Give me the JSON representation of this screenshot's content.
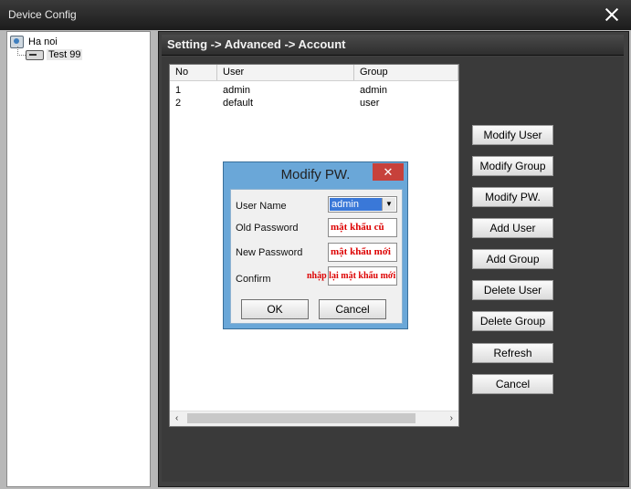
{
  "window": {
    "title": "Device Config"
  },
  "tree": {
    "root": "Ha noi",
    "child": "Test 99"
  },
  "breadcrumb": "Setting -> Advanced -> Account",
  "table": {
    "headers": {
      "no": "No",
      "user": "User",
      "group": "Group"
    },
    "rows": [
      {
        "no": "1",
        "user": "admin",
        "group": "admin"
      },
      {
        "no": "2",
        "user": "default",
        "group": "user"
      }
    ]
  },
  "buttons": {
    "modify_user": "Modify User",
    "modify_group": "Modify Group",
    "modify_pw": "Modify PW.",
    "add_user": "Add User",
    "add_group": "Add Group",
    "delete_user": "Delete User",
    "delete_group": "Delete Group",
    "refresh": "Refresh",
    "cancel": "Cancel"
  },
  "dialog": {
    "title": "Modify PW.",
    "close_glyph": "✕",
    "user_name_label": "User Name",
    "user_name_value": "admin",
    "old_password_label": "Old Password",
    "old_password_value": "mật khẩu cũ",
    "new_password_label": "New Password",
    "new_password_value": "mật khẩu mới",
    "confirm_label": "Confirm",
    "confirm_value": "nhập lại mật khẩu mới",
    "ok": "OK",
    "cancel": "Cancel"
  },
  "icons": {
    "close": "close-icon",
    "tree_root": "globe-icon",
    "tree_child": "device-icon",
    "dropdown": "chevron-down-icon"
  }
}
